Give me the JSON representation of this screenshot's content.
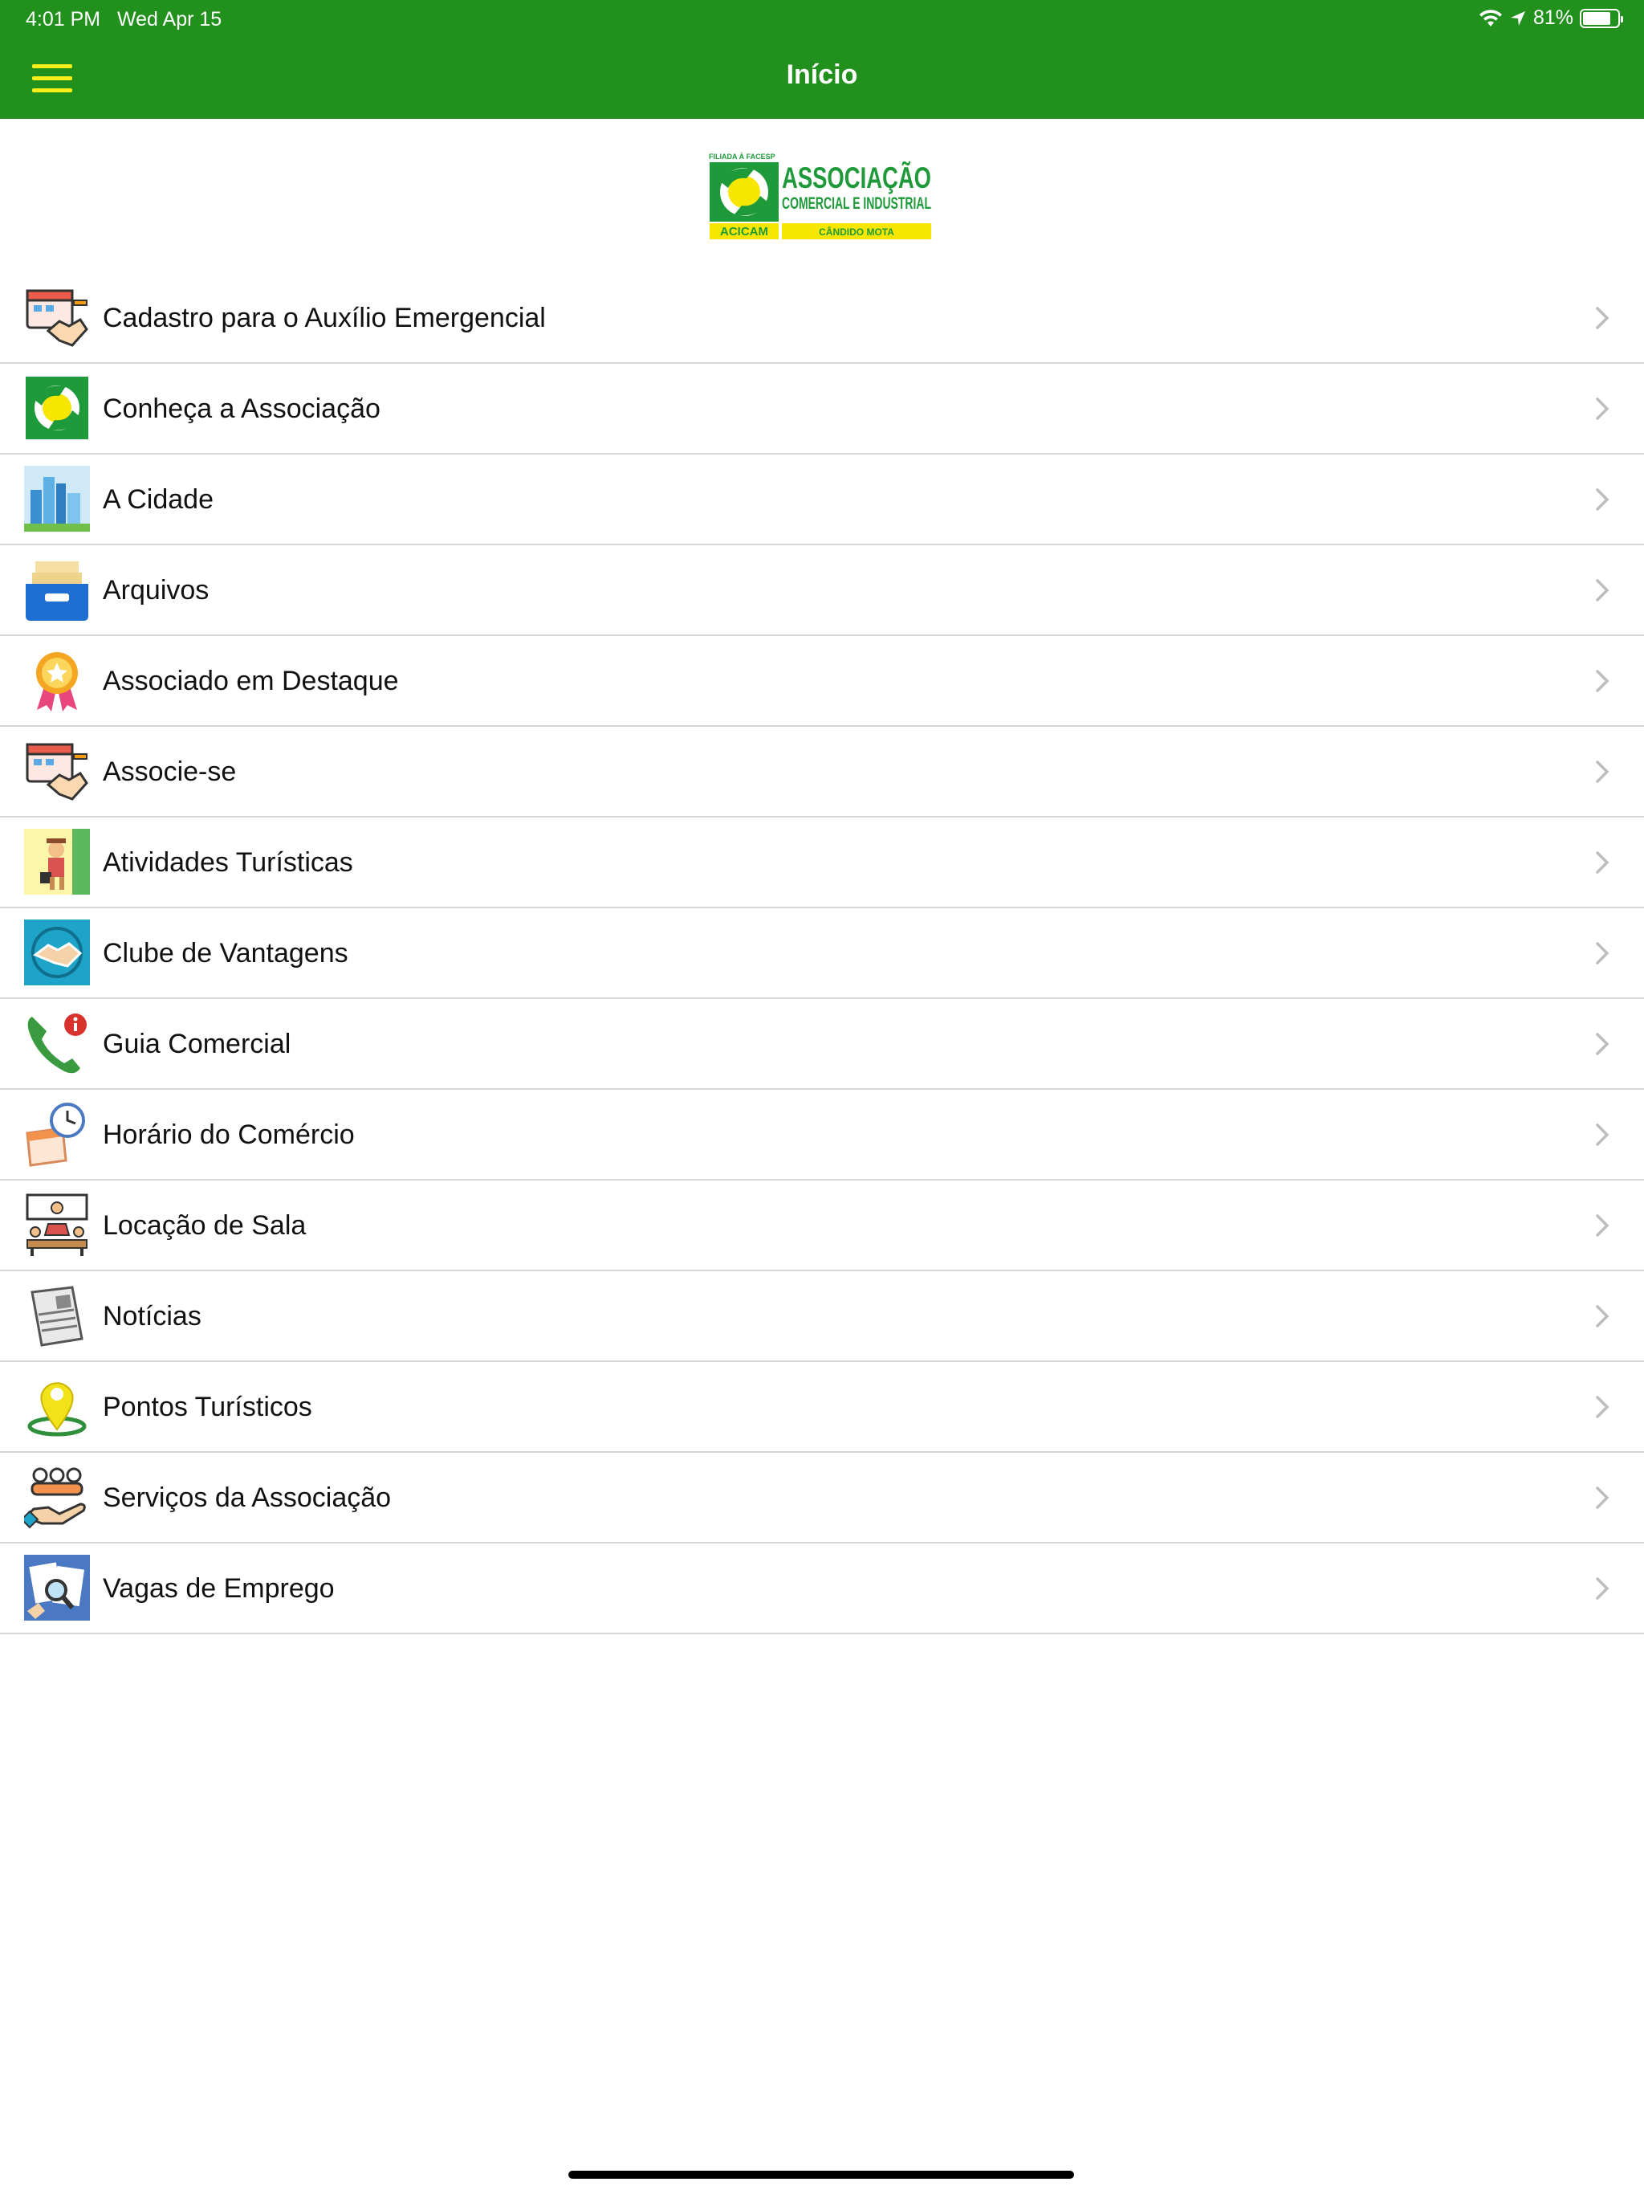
{
  "status_bar": {
    "time": "4:01 PM",
    "date": "Wed Apr 15",
    "battery": "81%"
  },
  "nav": {
    "title": "Início"
  },
  "logo": {
    "line1": "ASSOCIAÇÃO",
    "line2": "COMERCIAL E INDUSTRIAL",
    "top_text": "FILIADA À FACESP",
    "badge_left": "ACICAM",
    "badge_right": "CÂNDIDO MOTA"
  },
  "menu": [
    {
      "label": "Cadastro para o Auxílio Emergencial",
      "icon": "calendar-handshake-icon"
    },
    {
      "label": "Conheça a Associação",
      "icon": "association-logo-icon"
    },
    {
      "label": "A Cidade",
      "icon": "city-skyline-icon"
    },
    {
      "label": "Arquivos",
      "icon": "file-tray-icon"
    },
    {
      "label": "Associado em Destaque",
      "icon": "award-ribbon-icon"
    },
    {
      "label": "Associe-se",
      "icon": "calendar-handshake-icon"
    },
    {
      "label": "Atividades Turísticas",
      "icon": "tourist-icon"
    },
    {
      "label": "Clube de Vantagens",
      "icon": "handshake-club-icon"
    },
    {
      "label": "Guia Comercial",
      "icon": "phone-info-icon"
    },
    {
      "label": "Horário do Comércio",
      "icon": "clock-calendar-icon"
    },
    {
      "label": "Locação de Sala",
      "icon": "meeting-room-icon"
    },
    {
      "label": "Notícias",
      "icon": "newspaper-icon"
    },
    {
      "label": "Pontos Turísticos",
      "icon": "map-pin-icon"
    },
    {
      "label": "Serviços da Associação",
      "icon": "people-hand-icon"
    },
    {
      "label": "Vagas de Emprego",
      "icon": "job-search-icon"
    }
  ],
  "colors": {
    "header_green": "#21901d",
    "hamburger_yellow": "#f7ee1a",
    "logo_green": "#1f9a3a",
    "logo_yellow": "#f6e600"
  }
}
